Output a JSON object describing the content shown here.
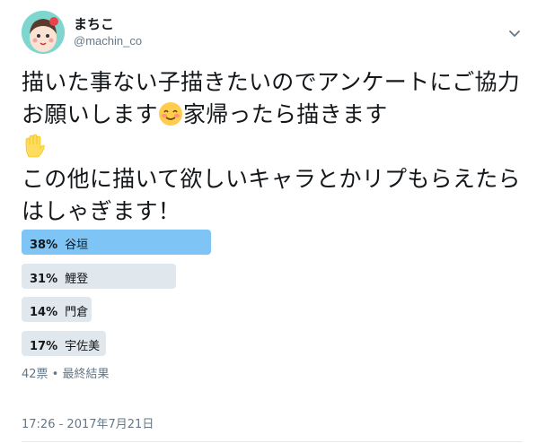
{
  "user": {
    "display_name": "まちこ",
    "handle": "@machin_co"
  },
  "icons": {
    "avatar": "avatar-illustration",
    "menu": "chevron-down-icon",
    "emoji_blush": "smiling-face-with-smiling-eyes",
    "emoji_hand": "raised-hand"
  },
  "tweet": {
    "part1": "描いた事ない子描きたいのでアンケートにご協力お願いします",
    "part2": "家帰ったら描きます",
    "part3": "この他に描いて欲しいキャラとかリプもらえたらはしゃぎます！"
  },
  "poll": {
    "options": [
      {
        "percent": "38%",
        "label": "谷垣",
        "share": 0.38,
        "winner": true
      },
      {
        "percent": "31%",
        "label": "鯉登",
        "share": 0.31,
        "winner": false
      },
      {
        "percent": "14%",
        "label": "門倉",
        "share": 0.14,
        "winner": false
      },
      {
        "percent": "17%",
        "label": "宇佐美",
        "share": 0.17,
        "winner": false
      }
    ],
    "meta": "42票 • 最終結果"
  },
  "colors": {
    "winner_bar": "#7ec4f5",
    "other_bar": "#e1e8ed",
    "muted_text": "#657786"
  },
  "timestamp": "17:26 - 2017年7月21日"
}
